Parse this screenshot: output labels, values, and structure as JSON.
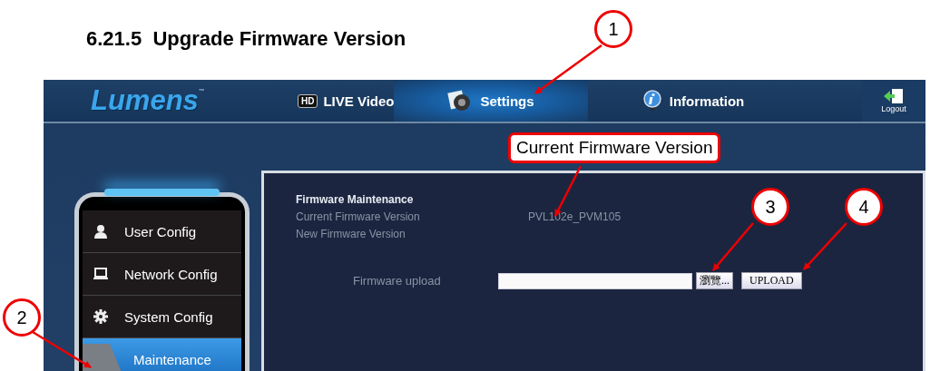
{
  "heading": "6.21.5  Upgrade Firmware Version",
  "app": {
    "logo": "Lumens",
    "logo_mark": "™",
    "nav": [
      {
        "kind": "hd",
        "badge": "HD",
        "label": "LIVE Video",
        "selected": false
      },
      {
        "kind": "settings",
        "label": "Settings",
        "selected": true
      },
      {
        "kind": "info",
        "label": "Information",
        "selected": false
      }
    ],
    "logout": "Logout",
    "sidebar": {
      "items": [
        {
          "kind": "user",
          "label": "User Config",
          "selected": false
        },
        {
          "kind": "network",
          "label": "Network Config",
          "selected": false
        },
        {
          "kind": "system",
          "label": "System Config",
          "selected": false
        },
        {
          "kind": "maintenance",
          "label": "Maintenance",
          "selected": true
        }
      ]
    },
    "panel": {
      "title": "Firmware Maintenance",
      "current_label": "Current Firmware Version",
      "current_value": "PVL102e_PVM105",
      "new_label": "New Firmware Version",
      "upload_label": "Firmware upload",
      "browse_button": "瀏覽...",
      "upload_button": "UPLOAD"
    }
  },
  "annotations": {
    "label_box": "Current Firmware Version",
    "callouts": [
      "1",
      "2",
      "3",
      "4"
    ]
  }
}
